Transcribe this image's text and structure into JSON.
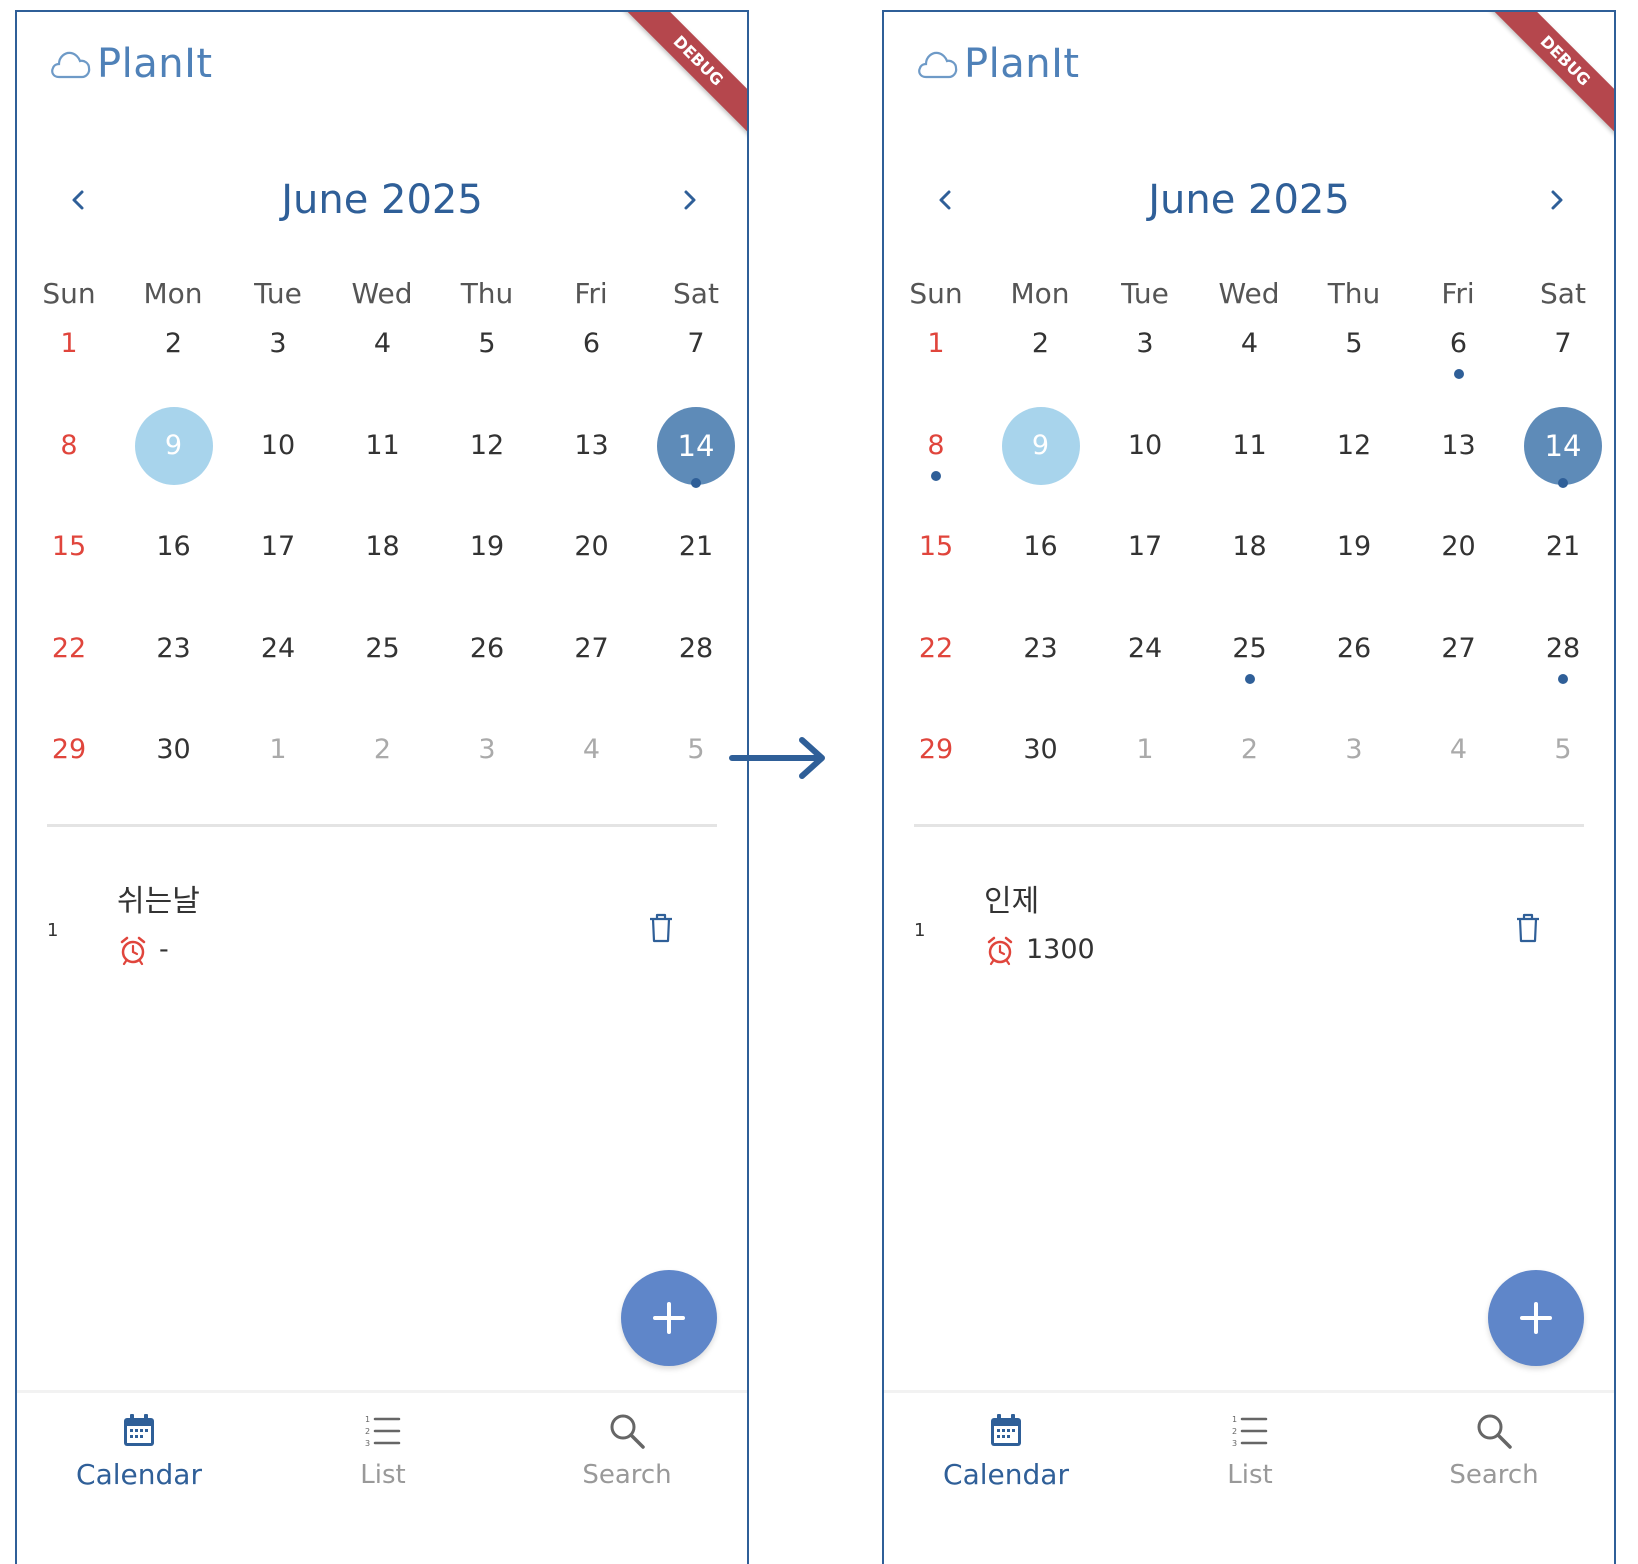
{
  "app": {
    "name": "PlanIt",
    "debug_label": "DEBUG"
  },
  "colors": {
    "primary": "#2f5f98",
    "sunday": "#e0453c",
    "today": "#a8d4ec",
    "selected": "#5e8bb8",
    "fab": "#5f86c9",
    "ribbon": "#b5474d"
  },
  "calendar": {
    "month_label": "June 2025",
    "weekdays": [
      "Sun",
      "Mon",
      "Tue",
      "Wed",
      "Thu",
      "Fri",
      "Sat"
    ],
    "weeks": [
      [
        {
          "d": "1"
        },
        {
          "d": "2"
        },
        {
          "d": "3"
        },
        {
          "d": "4"
        },
        {
          "d": "5"
        },
        {
          "d": "6"
        },
        {
          "d": "7"
        }
      ],
      [
        {
          "d": "8"
        },
        {
          "d": "9"
        },
        {
          "d": "10"
        },
        {
          "d": "11"
        },
        {
          "d": "12"
        },
        {
          "d": "13"
        },
        {
          "d": "14"
        }
      ],
      [
        {
          "d": "15"
        },
        {
          "d": "16"
        },
        {
          "d": "17"
        },
        {
          "d": "18"
        },
        {
          "d": "19"
        },
        {
          "d": "20"
        },
        {
          "d": "21"
        }
      ],
      [
        {
          "d": "22"
        },
        {
          "d": "23"
        },
        {
          "d": "24"
        },
        {
          "d": "25"
        },
        {
          "d": "26"
        },
        {
          "d": "27"
        },
        {
          "d": "28"
        }
      ],
      [
        {
          "d": "29"
        },
        {
          "d": "30"
        },
        {
          "d": "1",
          "out": true
        },
        {
          "d": "2",
          "out": true
        },
        {
          "d": "3",
          "out": true
        },
        {
          "d": "4",
          "out": true
        },
        {
          "d": "5",
          "out": true
        }
      ]
    ],
    "today": "9",
    "selected": "14"
  },
  "screens": [
    {
      "id": "before",
      "event_dots": [
        "14"
      ],
      "events": [
        {
          "index": "1",
          "title": "쉬는날",
          "time": "-"
        }
      ]
    },
    {
      "id": "after",
      "event_dots": [
        "6",
        "8",
        "14",
        "25",
        "28"
      ],
      "events": [
        {
          "index": "1",
          "title": "인제",
          "time": "1300"
        }
      ]
    }
  ],
  "bottom_nav": {
    "calendar": "Calendar",
    "list": "List",
    "search": "Search"
  },
  "icons": [
    "cloud-icon",
    "chevron-left-icon",
    "chevron-right-icon",
    "alarm-clock-icon",
    "trash-icon",
    "plus-icon",
    "calendar-icon",
    "list-icon",
    "search-icon",
    "arrow-right-icon"
  ]
}
